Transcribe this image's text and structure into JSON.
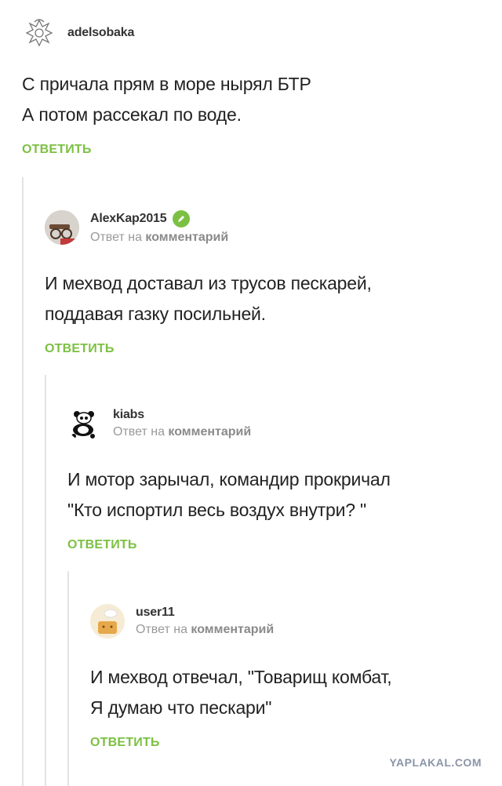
{
  "comments": [
    {
      "username": "adelsobaka",
      "reply_prefix": "",
      "reply_target": "",
      "lines": [
        "С причала прям в море нырял БТР",
        "А потом рассекал по воде."
      ],
      "reply_label": "ОТВЕТИТЬ",
      "avatar_icon": "dragon-emblem-icon"
    },
    {
      "username": "AlexKap2015",
      "verified": true,
      "reply_prefix": "Ответ на",
      "reply_target": "комментарий",
      "lines": [
        "И мехвод доставал из трусов пескарей,",
        "поддавая газку посильней."
      ],
      "reply_label": "ОТВЕТИТЬ",
      "avatar_icon": "cannon-avatar-icon"
    },
    {
      "username": "kiabs",
      "reply_prefix": "Ответ на",
      "reply_target": "комментарий",
      "lines": [
        "И мотор зарычал, командир прокричал",
        "\"Кто испортил весь воздух внутри? \""
      ],
      "reply_label": "ОТВЕТИТЬ",
      "avatar_icon": "panda-avatar-icon"
    },
    {
      "username": "user11",
      "reply_prefix": "Ответ на",
      "reply_target": "комментарий",
      "lines": [
        "И мехвод отвечал, \"Товарищ комбат,",
        "Я думаю что пескари\""
      ],
      "reply_label": "ОТВЕТИТЬ",
      "avatar_icon": "chef-avatar-icon"
    }
  ],
  "watermark": "YAPLAKAL.COM",
  "colors": {
    "accent": "#7cc043",
    "muted": "#9a9a9a",
    "thread_line": "#e3e3e3"
  }
}
